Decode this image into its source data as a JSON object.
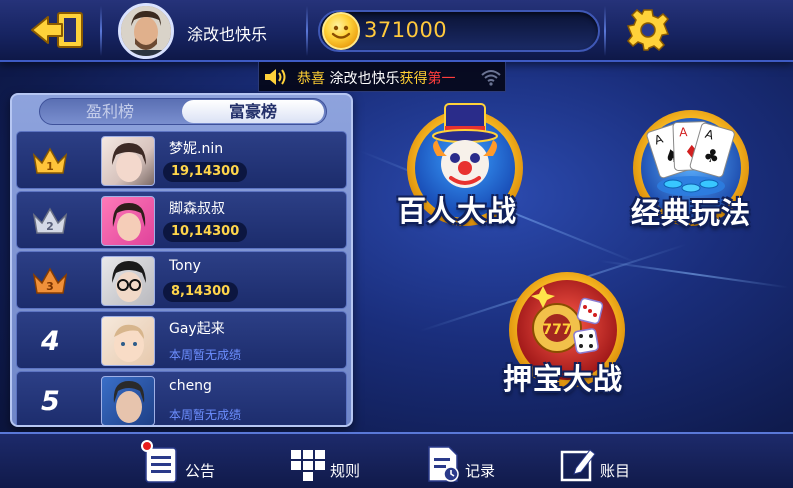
{
  "header": {
    "username": "涂改也快乐",
    "coins": "371000",
    "icons": [
      "back-exit-icon",
      "avatar",
      "gold-coin-icon",
      "gear-icon"
    ]
  },
  "broadcast": {
    "prefix": "恭喜",
    "name": "涂改也快乐",
    "verb": "获得",
    "rank": "第一",
    "icons": [
      "speaker-icon",
      "wifi-icon"
    ]
  },
  "leaderboard": {
    "tabs": [
      {
        "label": "盈利榜",
        "selected": false
      },
      {
        "label": "富豪榜",
        "selected": true
      }
    ],
    "rows": [
      {
        "rank": "1",
        "name": "梦妮.nin",
        "score": "19,14300",
        "medal": "gold-crown"
      },
      {
        "rank": "2",
        "name": "脚森叔叔",
        "score": "10,14300",
        "medal": "silver-crown"
      },
      {
        "rank": "3",
        "name": "Tony",
        "score": "8,14300",
        "medal": "bronze-crown"
      },
      {
        "rank": "4",
        "name": "Gay起来",
        "score": "本周暂无成绩"
      },
      {
        "rank": "5",
        "name": "cheng",
        "score": "本周暂无成绩"
      }
    ]
  },
  "games": [
    {
      "label": "百人大战",
      "icon": "clown-icon"
    },
    {
      "label": "经典玩法",
      "icon": "playing-cards-icon"
    },
    {
      "label": "押宝大战",
      "icon": "slot-dice-icon"
    }
  ],
  "bottom_nav": [
    {
      "label": "公告",
      "icon": "notice-list-icon"
    },
    {
      "label": "规则",
      "icon": "rules-grid-icon"
    },
    {
      "label": "记录",
      "icon": "record-document-icon"
    },
    {
      "label": "账目",
      "icon": "edit-ledger-icon"
    }
  ],
  "colors": {
    "gold": "#ffcf33",
    "highlight_red": "#ff3d3d",
    "background": "#1a2e7c",
    "no_score_blue": "#6d8fff"
  }
}
